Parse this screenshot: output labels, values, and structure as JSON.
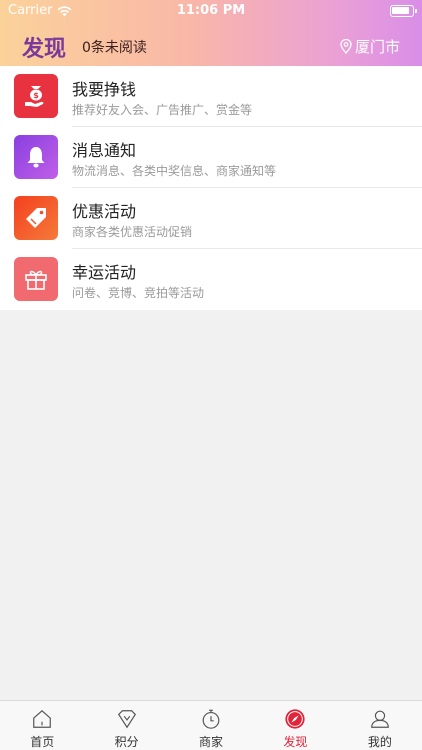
{
  "status_bar": {
    "carrier": "Carrier",
    "time": "11:06 PM"
  },
  "header": {
    "title": "发现",
    "unread": "0条未阅读",
    "location": "厦门市"
  },
  "colors": {
    "header_title": "#7b3a9a",
    "active_tab": "#e0243a"
  },
  "list": [
    {
      "title": "我要挣钱",
      "subtitle": "推荐好友入会、广告推广、赏金等",
      "icon": "money-hand-icon",
      "color": "#e8323f"
    },
    {
      "title": "消息通知",
      "subtitle": "物流消息、各类中奖信息、商家通知等",
      "icon": "bell-icon",
      "color": "#9a45e0"
    },
    {
      "title": "优惠活动",
      "subtitle": "商家各类优惠活动促销",
      "icon": "tag-icon",
      "color": "#f2502d"
    },
    {
      "title": "幸运活动",
      "subtitle": "问卷、竞博、竞拍等活动",
      "icon": "gift-icon",
      "color": "#f06a70"
    }
  ],
  "tabs": [
    {
      "label": "首页",
      "icon": "home-icon",
      "active": false
    },
    {
      "label": "积分",
      "icon": "diamond-icon",
      "active": false
    },
    {
      "label": "商家",
      "icon": "stopwatch-icon",
      "active": false
    },
    {
      "label": "发现",
      "icon": "compass-icon",
      "active": true
    },
    {
      "label": "我的",
      "icon": "user-icon",
      "active": false
    }
  ]
}
